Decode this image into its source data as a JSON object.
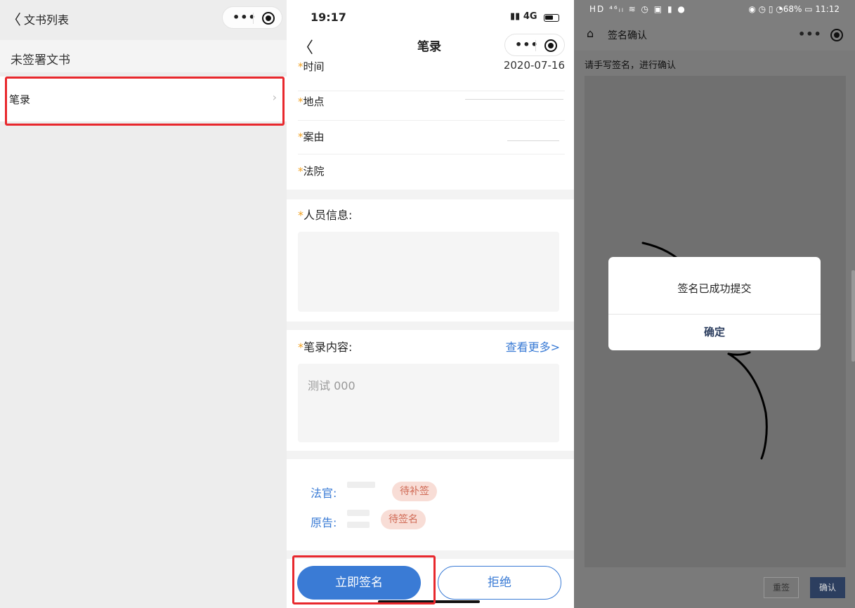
{
  "panel_list": {
    "nav_back": "〈",
    "nav_title": "文书列表",
    "section_title": "未签署文书",
    "row_label": "笔录",
    "row_chevron": "›"
  },
  "panel_form": {
    "status_time": "19:17",
    "status_network": "4G",
    "nav_back": "〈",
    "nav_title": "笔录",
    "fields": [
      {
        "label": "时间",
        "value": "2020-07-16"
      },
      {
        "label": "地点",
        "value": ""
      },
      {
        "label": "案由",
        "value": ""
      },
      {
        "label": "法院",
        "value": ""
      }
    ],
    "required_mark": "*",
    "personnel_title": "人员信息:",
    "content_title": "笔录内容:",
    "view_more": "查看更多>",
    "content_text": "测试 000",
    "signers": [
      {
        "role": "法官:",
        "status": "待补签"
      },
      {
        "role": "原告:",
        "status": "待签名"
      }
    ],
    "sign_button": "立即签名",
    "reject_button": "拒绝"
  },
  "panel_sign": {
    "status_left": "HD ⁴⁶ᵢₗ ≋ ◷ ▣ ▮ ●",
    "status_right": "◉ ◷ ▯ ◔68% ▭ 11:12",
    "nav_home_icon": "⌂",
    "nav_title": "签名确认",
    "hint": "请手写签名，进行确认",
    "reset_button": "重签",
    "confirm_button": "确认",
    "dialog": {
      "message": "签名已成功提交",
      "ok_button": "确定"
    }
  },
  "colors": {
    "accent": "#3a7bd5",
    "highlight_box": "#e8282d",
    "tag_background": "#f8ddd6",
    "tag_text": "#d06a55",
    "required_star": "#f0a020"
  },
  "icons": {
    "capsule_more": "•••",
    "capsule_close": "target-icon"
  }
}
